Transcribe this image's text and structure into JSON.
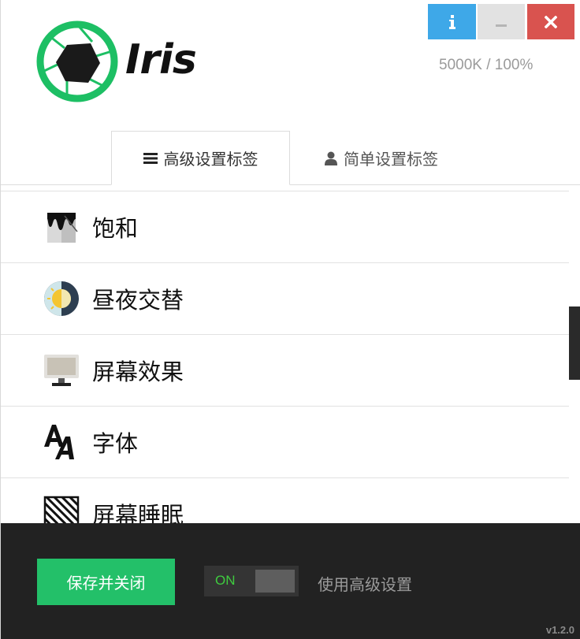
{
  "app": {
    "name": "Iris",
    "status": "5000K / 100%",
    "version": "v1.2.0"
  },
  "window_controls": {
    "info_icon": "info-icon",
    "minimize_icon": "minimize-icon",
    "close_icon": "close-icon"
  },
  "tabs": [
    {
      "label": "高级设置标签",
      "icon": "list-icon",
      "active": true
    },
    {
      "label": "简单设置标签",
      "icon": "user-icon",
      "active": false
    }
  ],
  "menu": {
    "items": [
      {
        "label": "饱和",
        "icon": "saturation-icon"
      },
      {
        "label": "昼夜交替",
        "icon": "day-night-icon"
      },
      {
        "label": "屏幕效果",
        "icon": "monitor-icon"
      },
      {
        "label": "字体",
        "icon": "font-icon"
      },
      {
        "label": "屏幕睡眠",
        "icon": "screen-sleep-icon"
      }
    ]
  },
  "footer": {
    "save_label": "保存并关闭",
    "toggle_label": "ON",
    "advanced_label": "使用高级设置"
  },
  "colors": {
    "info": "#3ea8e8",
    "minimize": "#e2e2e2",
    "close": "#d9534f",
    "save": "#23c069",
    "logo_green": "#1dbf64",
    "footer_bg": "#222222"
  }
}
